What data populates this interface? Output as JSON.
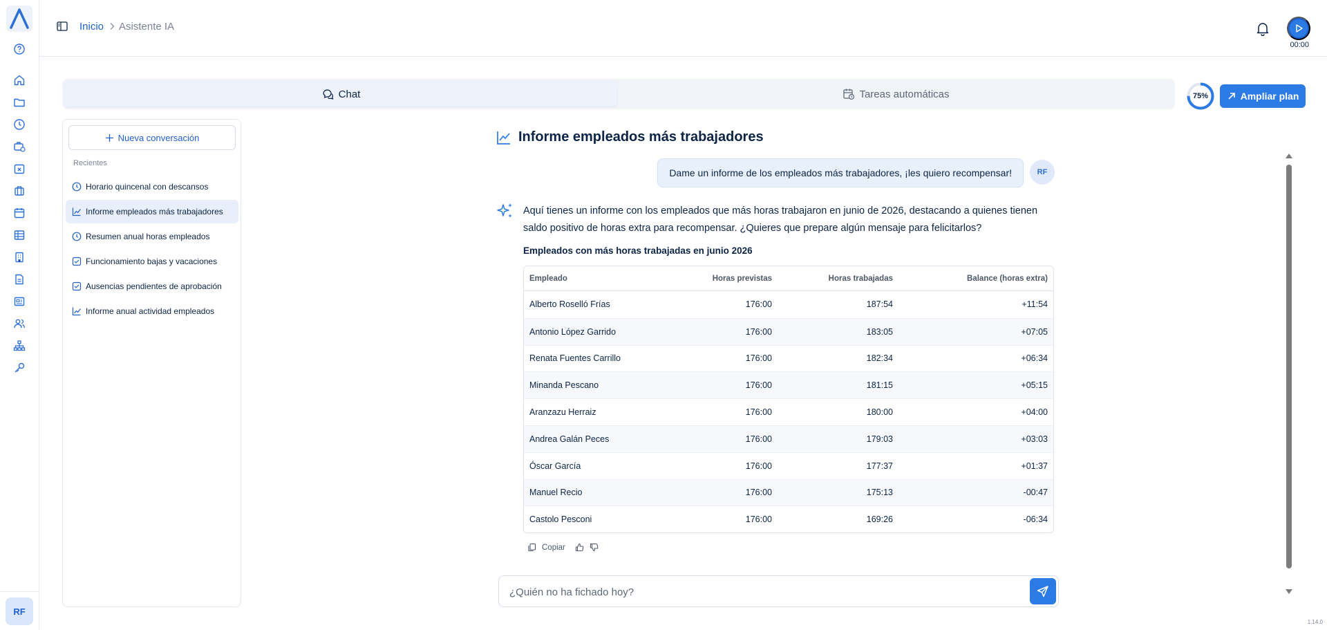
{
  "header": {
    "breadcrumb": {
      "home": "Inicio",
      "current": "Asistente IA"
    },
    "timer": "00:00"
  },
  "tabs": [
    {
      "label": "Chat",
      "icon": "chat-bubbles-icon",
      "active": true
    },
    {
      "label": "Tareas automáticas",
      "icon": "calendar-clock-icon",
      "active": false
    }
  ],
  "plan": {
    "usage": "75%",
    "usage_fraction": 0.75,
    "upgrade_label": "Ampliar plan"
  },
  "sidebar": {
    "new_conversation": "Nueva conversación",
    "recent_label": "Recientes",
    "conversations": [
      {
        "title": "Horario quincenal con descansos",
        "icon": "clock-icon",
        "selected": false
      },
      {
        "title": "Informe empleados más trabajadores",
        "icon": "chart-line-icon",
        "selected": true
      },
      {
        "title": "Resumen anual horas empleados",
        "icon": "clock-icon",
        "selected": false
      },
      {
        "title": "Funcionamiento bajas y vacaciones",
        "icon": "checkbox-icon",
        "selected": false
      },
      {
        "title": "Ausencias pendientes de aprobación",
        "icon": "checkbox-icon",
        "selected": false
      },
      {
        "title": "Informe anual actividad empleados",
        "icon": "chart-line-icon",
        "selected": false
      }
    ]
  },
  "rail": {
    "user_initials": "RF",
    "icons": [
      "help-icon",
      "home-icon",
      "folder-icon",
      "clock-icon",
      "briefcase-clock-icon",
      "calendar-x-icon",
      "suitcase-icon",
      "calendar-icon",
      "table-icon",
      "building-icon",
      "document-icon",
      "newspaper-icon",
      "users-icon",
      "org-chart-icon",
      "key-icon"
    ]
  },
  "chat": {
    "title": "Informe empleados más trabajadores",
    "user_message": "Dame un informe de los empleados más trabajadores, ¡les quiero recompensar!",
    "user_initials": "RF",
    "assistant_message": "Aquí tienes un informe con los empleados que más horas trabajaron en junio de 2026, destacando a quienes tienen saldo positivo de horas extra para recompensar. ¿Quieres que prepare algún mensaje para felicitarlos?",
    "table_title": "Empleados con más horas trabajadas en junio 2026",
    "table": {
      "headers": [
        "Empleado",
        "Horas previstas",
        "Horas trabajadas",
        "Balance (horas extra)"
      ],
      "rows": [
        [
          "Alberto Roselló Frías",
          "176:00",
          "187:54",
          "+11:54"
        ],
        [
          "Antonio López Garrido",
          "176:00",
          "183:05",
          "+07:05"
        ],
        [
          "Renata Fuentes Carrillo",
          "176:00",
          "182:34",
          "+06:34"
        ],
        [
          "Minanda Pescano",
          "176:00",
          "181:15",
          "+05:15"
        ],
        [
          "Aranzazu Herraiz",
          "176:00",
          "180:00",
          "+04:00"
        ],
        [
          "Andrea Galán Peces",
          "176:00",
          "179:03",
          "+03:03"
        ],
        [
          "Óscar García",
          "176:00",
          "177:37",
          "+01:37"
        ],
        [
          "Manuel Recio",
          "176:00",
          "175:13",
          "-00:47"
        ],
        [
          "Castolo Pesconi",
          "176:00",
          "169:26",
          "-06:34"
        ]
      ]
    },
    "copy_label": "Copiar",
    "input_placeholder": "¿Quién no ha fichado hoy?"
  },
  "version": "1.14.0",
  "colors": {
    "accent": "#2c7be5",
    "navy": "#0b2447",
    "selected": "#e8eefa"
  }
}
